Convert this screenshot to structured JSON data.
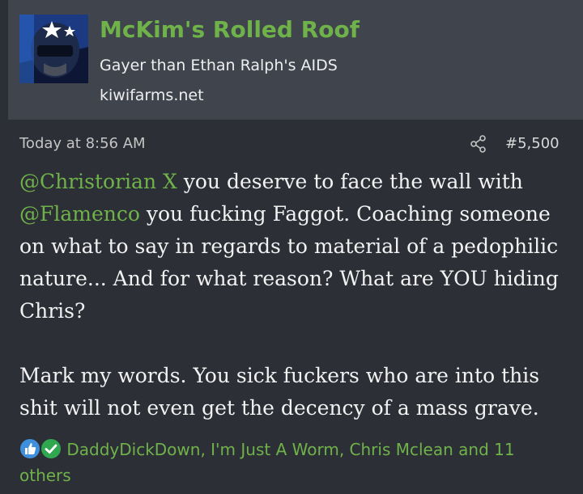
{
  "user": {
    "name": "McKim's Rolled Roof",
    "title": "Gayer than Ethan Ralph's AIDS",
    "site": "kiwifarms.net"
  },
  "post": {
    "time": "Today at 8:56 AM",
    "number": "#5,500",
    "mention1": "@Christorian X",
    "text1": " you deserve to face the wall with ",
    "mention2": "@Flamenco",
    "text2": " you fucking Faggot. Coaching someone on what to say in regards to material of a pedophilic nature... And for what reason? What are YOU hiding Chris?",
    "paragraph2": "Mark my words. You sick fuckers who are into this shit will not even get the decency of a mass grave."
  },
  "reactions": {
    "users": "DaddyDickDown, I'm Just A Worm, Chris Mclean and 11 others",
    "icons": [
      "thumbs-up-icon",
      "checkmark-icon"
    ],
    "colors": {
      "like": "#3f8fdc",
      "check": "#2fa84f"
    }
  },
  "colors": {
    "accent": "#6fb24a",
    "background": "#2c2f36",
    "header": "#3f444d"
  }
}
